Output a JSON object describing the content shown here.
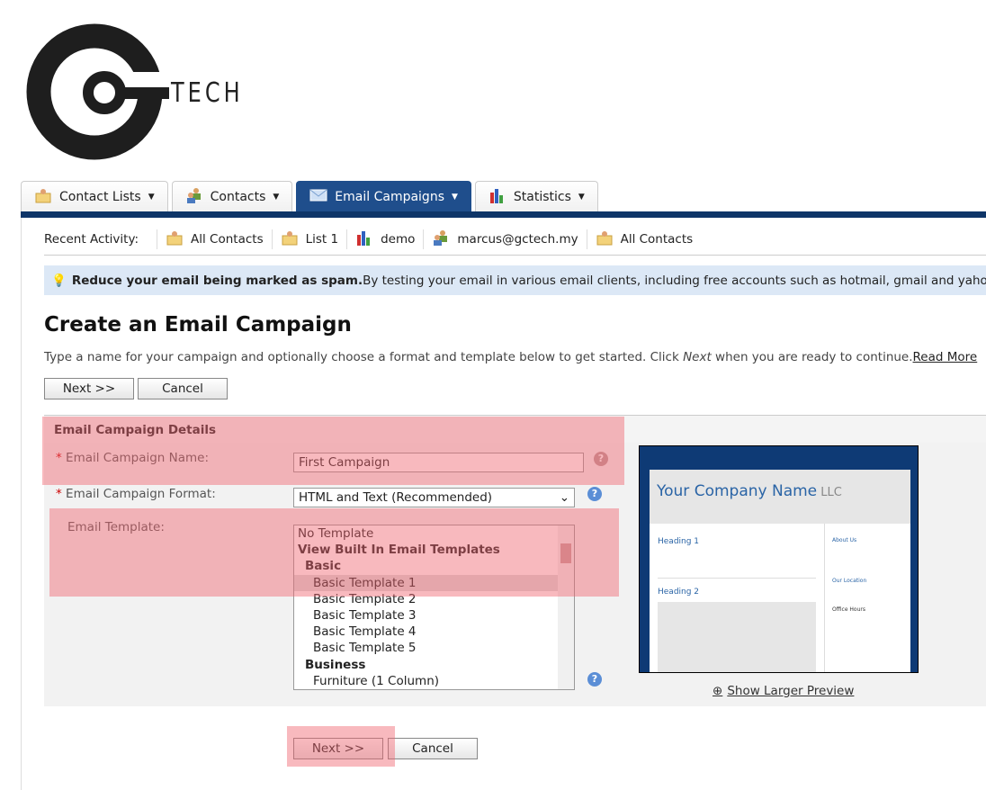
{
  "brand": {
    "logo_text": "TECH"
  },
  "tabs": [
    {
      "label": "Contact Lists",
      "icon": "contact-list-icon"
    },
    {
      "label": "Contacts",
      "icon": "contacts-icon"
    },
    {
      "label": "Email Campaigns",
      "icon": "envelope-icon",
      "active": true
    },
    {
      "label": "Statistics",
      "icon": "bar-chart-icon"
    }
  ],
  "recent": {
    "label": "Recent Activity:",
    "items": [
      {
        "label": "All Contacts",
        "icon": "contact-list-icon"
      },
      {
        "label": "List 1",
        "icon": "contact-list-icon"
      },
      {
        "label": "demo",
        "icon": "bar-chart-icon"
      },
      {
        "label": "marcus@gctech.my",
        "icon": "contacts-icon"
      },
      {
        "label": "All Contacts",
        "icon": "contact-list-icon"
      }
    ]
  },
  "tip": {
    "bold": "Reduce your email being marked as spam.",
    "text": " By testing your email in various email clients, including free accounts such as hotmail, gmail and yahoo you can reduce"
  },
  "page": {
    "title": "Create an Email Campaign",
    "desc_a": "Type a name for your campaign and optionally choose a format and template below to get started. Click ",
    "desc_em": "Next",
    "desc_b": " when you are ready to continue.",
    "read_more": "Read More"
  },
  "buttons": {
    "next": "Next >>",
    "cancel": "Cancel"
  },
  "details": {
    "header": "Email Campaign Details",
    "name_label": "Email Campaign Name:",
    "name_value": "First Campaign",
    "format_label": "Email Campaign Format:",
    "format_value": "HTML and Text (Recommended)",
    "template_label": "Email Template:",
    "req": "*",
    "help": "?"
  },
  "templates": [
    {
      "label": "No Template",
      "kind": "o"
    },
    {
      "label": "View Built In Email Templates",
      "kind": "g"
    },
    {
      "label": "Basic",
      "kind": "sg"
    },
    {
      "label": "Basic Template 1",
      "kind": "t",
      "selected": true
    },
    {
      "label": "Basic Template 2",
      "kind": "t"
    },
    {
      "label": "Basic Template 3",
      "kind": "t"
    },
    {
      "label": "Basic Template 4",
      "kind": "t"
    },
    {
      "label": "Basic Template 5",
      "kind": "t"
    },
    {
      "label": "Business",
      "kind": "sg"
    },
    {
      "label": "Furniture (1 Column)",
      "kind": "t"
    }
  ],
  "preview": {
    "company": "Your Company Name",
    "llc": "LLC",
    "heading1": "Heading 1",
    "heading2": "Heading 2",
    "about": "About Us",
    "location": "Our Location",
    "hours": "Office Hours",
    "show_larger": "Show Larger Preview"
  }
}
